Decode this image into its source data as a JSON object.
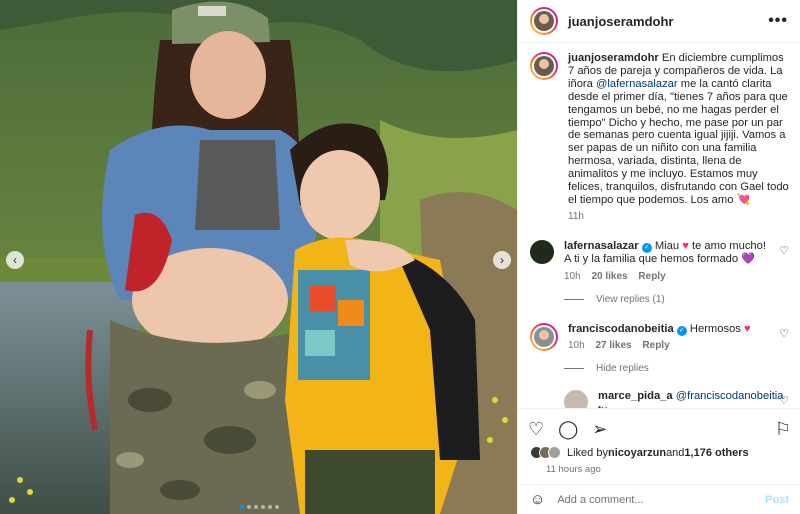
{
  "post": {
    "author": "juanjoseramdohr",
    "caption_parts": {
      "before_mention": "En diciembre cumplimos 7 años de pareja y compañeros de vida. La iñora ",
      "mention": "@lafernasalazar",
      "after_mention": " me la cantó clarita desde el primer día, \"tienes 7 años para que tengamos un bebé, no me hagas perder el tiempo\" Dicho y hecho, me pase por un par de semanas pero cuenta igual jijiji. Vamos a ser papas de un niñito con una familia hermosa, variada, distinta, llena de animalitos y me incluyo. Estamos muy felices, tranquilos, disfrutando con Gael todo el tiempo que podemos. Los amo ",
      "emoji": "💘"
    },
    "caption_age": "11h",
    "more_label": "•••"
  },
  "comments": [
    {
      "user": "lafernasalazar",
      "text_before_emoji": " Miau ",
      "emoji1": "♥",
      "text_after_emoji": " te amo mucho! A ti y la familia que hemos formado ",
      "emoji2": "💜",
      "age": "10h",
      "likes": "20 likes",
      "reply_label": "Reply",
      "view_replies": "View replies (1)"
    },
    {
      "user": "franciscodanobeitia",
      "text": " Hermosos ",
      "emoji": "♥",
      "age": "10h",
      "likes": "27 likes",
      "reply_label": "Reply",
      "hide_replies": "Hide replies"
    }
  ],
  "reply": {
    "user": "marce_pida_a",
    "mention": "@franciscodanobeitia",
    "text": " tu"
  },
  "actions": {
    "like_icon": "heart-icon",
    "comment_icon": "comment-icon",
    "share_icon": "share-icon",
    "save_icon": "bookmark-icon"
  },
  "likes_summary": {
    "prefix": "Liked by ",
    "user": "nicoyarzun",
    "middle": " and ",
    "others": "1,176 others"
  },
  "timestamp": "11 hours ago",
  "add_comment": {
    "placeholder": "Add a comment...",
    "post_label": "Post"
  },
  "carousel": {
    "total_dots": 6,
    "active_index": 0
  }
}
